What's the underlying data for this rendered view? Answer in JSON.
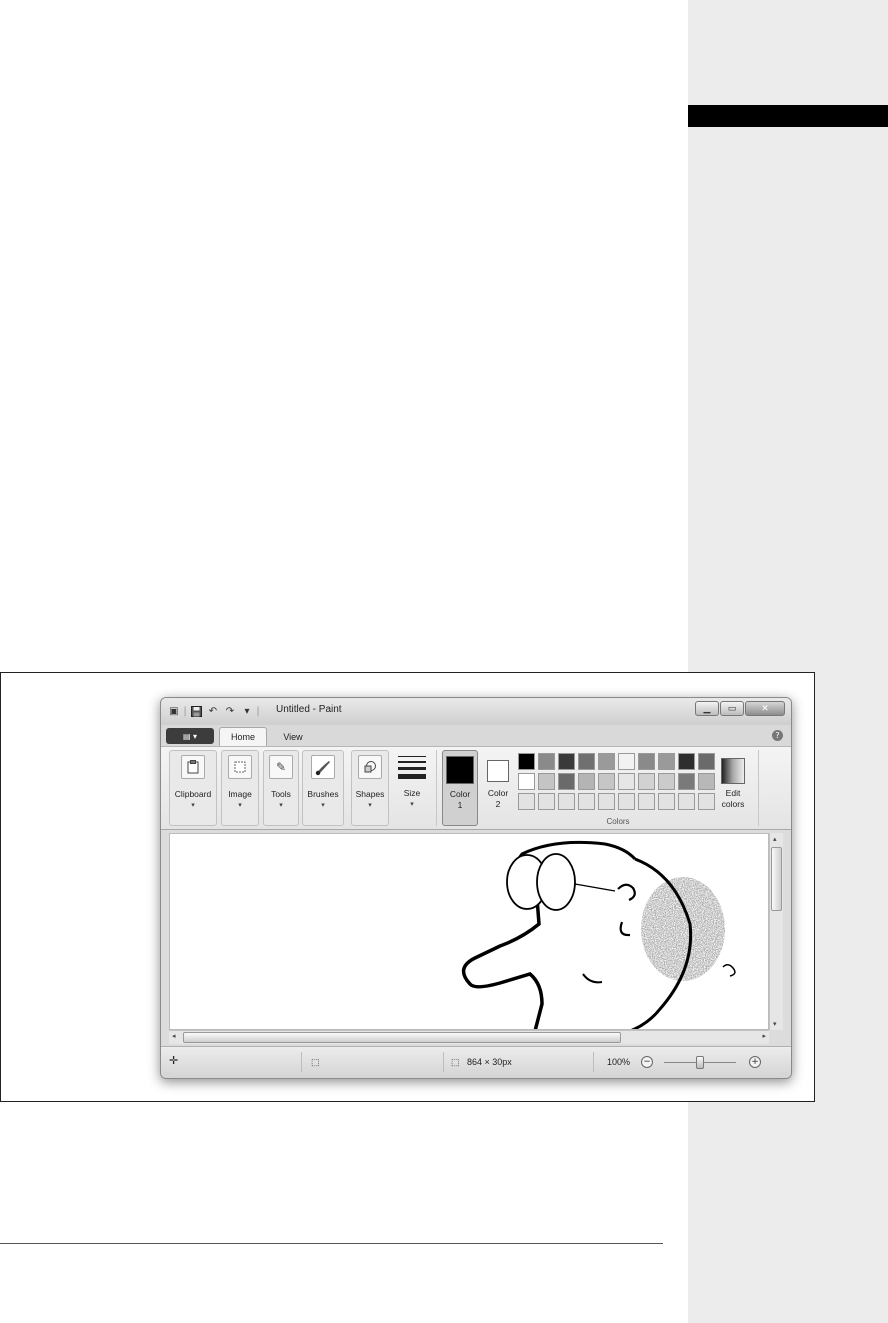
{
  "window": {
    "title": "Untitled - Paint"
  },
  "tabs": {
    "home": "Home",
    "view": "View"
  },
  "ribbon": {
    "clipboard": "Clipboard",
    "image": "Image",
    "tools": "Tools",
    "brushes": "Brushes",
    "shapes": "Shapes",
    "size": "Size",
    "color1_line1": "Color",
    "color1_line2": "1",
    "color2_line1": "Color",
    "color2_line2": "2",
    "colors_group": "Colors",
    "edit_colors_line1": "Edit",
    "edit_colors_line2": "colors"
  },
  "palette": [
    "#000000",
    "#8a8a8a",
    "#3a3a3a",
    "#707070",
    "#9a9a9a",
    "#f2f2f2",
    "#8a8a8a",
    "#9a9a9a",
    "#2e2e2e",
    "#6a6a6a",
    "#ffffff",
    "#c4c4c4",
    "#6a6a6a",
    "#b4b4b4",
    "#c6c6c6",
    "#e6e6e6",
    "#d2d2d2",
    "#cbcbcb",
    "#7a7a7a",
    "#b8b8b8",
    "#e2e2e2",
    "#e2e2e2",
    "#e2e2e2",
    "#e2e2e2",
    "#e2e2e2",
    "#e2e2e2",
    "#e2e2e2",
    "#e2e2e2",
    "#e2e2e2",
    "#e2e2e2"
  ],
  "status": {
    "dimensions": "864 × 30px",
    "zoom": "100%",
    "zoom_level": 0.5
  }
}
